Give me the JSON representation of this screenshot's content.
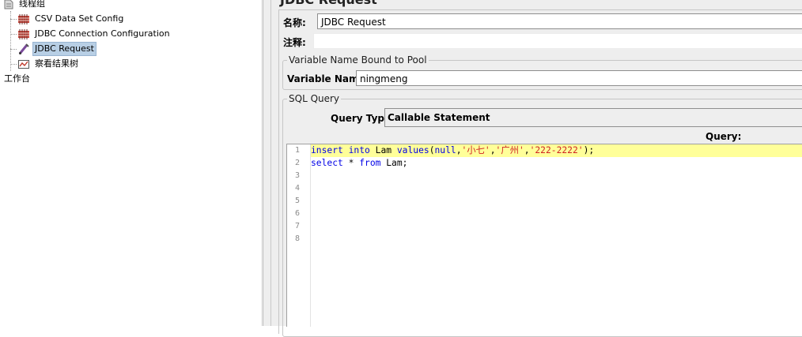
{
  "tree": {
    "items": [
      {
        "label": "线程组",
        "icon": "thread-group-icon"
      },
      {
        "label": "CSV Data Set Config",
        "icon": "csv-config-icon"
      },
      {
        "label": "JDBC Connection Configuration",
        "icon": "jdbc-connection-icon"
      },
      {
        "label": "JDBC Request",
        "icon": "jdbc-request-icon",
        "selected": true
      },
      {
        "label": "察看结果树",
        "icon": "view-results-tree-icon"
      },
      {
        "label": "工作台",
        "icon": ""
      }
    ]
  },
  "panel": {
    "title": "JDBC Request",
    "name_label": "名称:",
    "name_value": "JDBC Request",
    "comment_label": "注释:",
    "comment_value": "",
    "pool_group_title": "Variable Name Bound to Pool",
    "variable_name_label": "Variable Name:",
    "variable_name_value": "ningmeng",
    "sql_group_title": "SQL Query",
    "query_type_label": "Query Type:",
    "query_type_value": "Callable Statement",
    "query_label": "Query:"
  },
  "editor": {
    "line_numbers": [
      "1",
      "2",
      "3",
      "4",
      "5",
      "6",
      "7",
      "8"
    ],
    "lines": [
      "insert into Lam values(null,'小七','广州','222-2222');",
      "select * from Lam;"
    ]
  },
  "colors": {
    "highlight_line": "#ffff99",
    "keyword": "#0000e6",
    "string": "#d02323",
    "selection": "#b8cfe5"
  }
}
